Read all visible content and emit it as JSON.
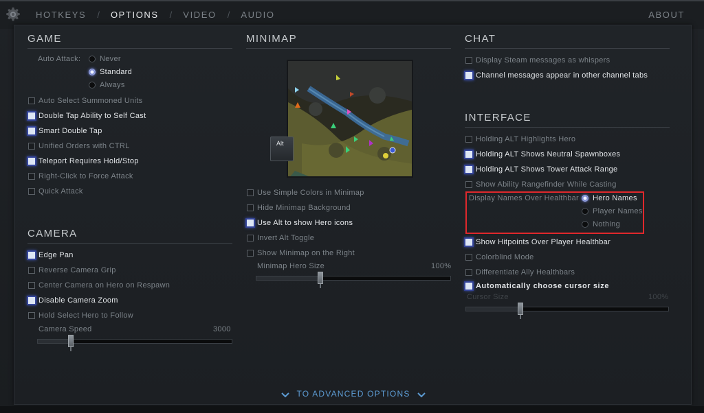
{
  "nav": {
    "tabs": [
      "HOTKEYS",
      "OPTIONS",
      "VIDEO",
      "AUDIO"
    ],
    "active": "OPTIONS",
    "about": "ABOUT"
  },
  "game": {
    "title": "GAME",
    "auto_attack_label": "Auto Attack:",
    "auto_attack_options": [
      "Never",
      "Standard",
      "Always"
    ],
    "auto_attack_selected": "Standard",
    "checkboxes": [
      {
        "label": "Auto Select Summoned Units",
        "checked": false
      },
      {
        "label": "Double Tap Ability to Self Cast",
        "checked": true
      },
      {
        "label": "Smart Double Tap",
        "checked": true
      },
      {
        "label": "Unified Orders with CTRL",
        "checked": false
      },
      {
        "label": "Teleport Requires Hold/Stop",
        "checked": true
      },
      {
        "label": "Right-Click to Force Attack",
        "checked": false
      },
      {
        "label": "Quick Attack",
        "checked": false
      }
    ]
  },
  "camera": {
    "title": "CAMERA",
    "checkboxes": [
      {
        "label": "Edge Pan",
        "checked": true
      },
      {
        "label": "Reverse Camera Grip",
        "checked": false
      },
      {
        "label": "Center Camera on Hero on Respawn",
        "checked": false
      },
      {
        "label": "Disable Camera Zoom",
        "checked": true
      },
      {
        "label": "Hold Select Hero to Follow",
        "checked": false
      }
    ],
    "speed_label": "Camera Speed",
    "speed_value": "3000",
    "speed_fraction": 0.17
  },
  "minimap": {
    "title": "MINIMAP",
    "alt_key": "Alt",
    "checkboxes": [
      {
        "label": "Use Simple Colors in Minimap",
        "checked": false
      },
      {
        "label": "Hide Minimap Background",
        "checked": false
      },
      {
        "label": "Use Alt to show Hero icons",
        "checked": true
      },
      {
        "label": "Invert Alt Toggle",
        "checked": false
      },
      {
        "label": "Show Minimap on the Right",
        "checked": false
      }
    ],
    "hero_size_label": "Minimap Hero Size",
    "hero_size_value": "100%",
    "hero_size_fraction": 0.33
  },
  "chat": {
    "title": "CHAT",
    "checkboxes": [
      {
        "label": "Display Steam messages as whispers",
        "checked": false
      },
      {
        "label": "Channel messages appear in other channel tabs",
        "checked": true
      }
    ]
  },
  "interface": {
    "title": "INTERFACE",
    "checkboxes_top": [
      {
        "label": "Holding ALT Highlights Hero",
        "checked": false
      },
      {
        "label": "Holding ALT Shows Neutral Spawnboxes",
        "checked": true
      },
      {
        "label": "Holding ALT Shows Tower Attack Range",
        "checked": true
      },
      {
        "label": "Show Ability Rangefinder While Casting",
        "checked": false
      }
    ],
    "names_label": "Display Names Over Healthbar",
    "names_options": [
      "Hero Names",
      "Player Names",
      "Nothing"
    ],
    "names_selected": "Hero Names",
    "checkboxes_bottom": [
      {
        "label": "Show Hitpoints Over Player Healthbar",
        "checked": true
      },
      {
        "label": "Colorblind Mode",
        "checked": false
      },
      {
        "label": "Differentiate Ally Healthbars",
        "checked": false
      },
      {
        "label": "Automatically choose cursor size",
        "checked": true
      }
    ],
    "cursor_size_label": "Cursor Size",
    "cursor_size_value": "100%",
    "cursor_size_fraction": 0.27
  },
  "advanced": "TO ADVANCED OPTIONS",
  "colors": {
    "accent_blue": "#5d9cd4",
    "highlight_red": "#e0282c",
    "checked_glow": "#3c4fa8"
  }
}
